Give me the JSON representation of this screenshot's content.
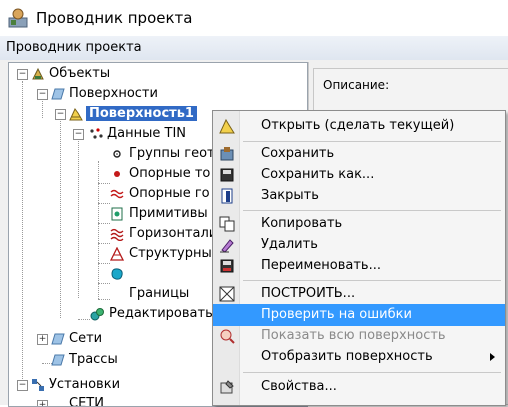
{
  "window": {
    "title": "Проводник проекта"
  },
  "panel": {
    "header": "Проводник проекта"
  },
  "description": {
    "label": "Описание:"
  },
  "tree": {
    "objects": "Объекты",
    "surfaces": "Поверхности",
    "surface1": "Поверхность1",
    "tin": "Данные TIN",
    "groups": "Группы геот",
    "ref_points": "Опорные то",
    "ref_contours": "Опорные го",
    "primitives": "Примитивы",
    "contours": "Горизонтали",
    "structural": "Структурные",
    "boundaries": "Границы",
    "edit": "Редактировать",
    "networks": "Сети",
    "alignments": "Трассы",
    "settings": "Установки",
    "settings_networks": "СЕТИ"
  },
  "menu": {
    "open": "Открыть (сделать текущей)",
    "save": "Сохранить",
    "save_as": "Сохранить как...",
    "close": "Закрыть",
    "copy": "Копировать",
    "delete": "Удалить",
    "rename": "Переименовать...",
    "build": "ПОСТРОИТЬ...",
    "check": "Проверить на ошибки",
    "show_all": "Показать всю поверхность",
    "display": "Отобразить поверхность",
    "properties": "Свойства..."
  },
  "colors": {
    "selection": "#316ac5",
    "menu_highlight": "#3399ff"
  }
}
